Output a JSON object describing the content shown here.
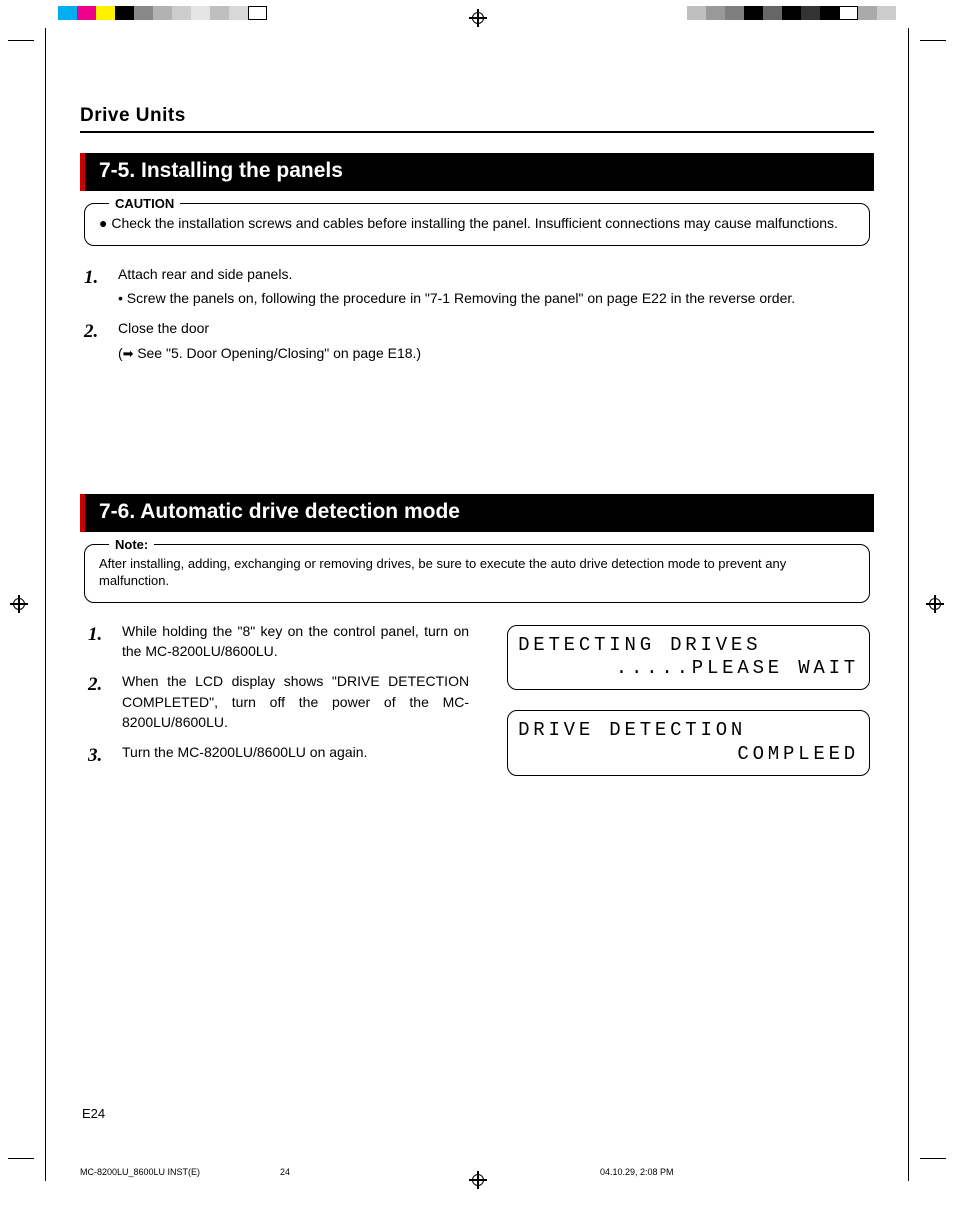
{
  "header": "Drive Units",
  "section75": {
    "title": "7-5. Installing the panels",
    "caution_label": "CAUTION",
    "caution_text": "● Check the installation screws and cables before installing the panel. Insufficient connections may cause malfunctions.",
    "steps": [
      {
        "num": "1.",
        "main": "Attach rear and side panels.",
        "sub": "Screw the panels on, following the procedure in \"7-1 Removing the panel\" on page E22 in the reverse order."
      },
      {
        "num": "2.",
        "main": "Close the door",
        "ref": "See \"5. Door Opening/Closing\" on page E18.)"
      }
    ]
  },
  "section76": {
    "title": "7-6. Automatic drive detection mode",
    "note_label": "Note:",
    "note_text": "After installing, adding, exchanging or removing drives, be sure to execute the auto drive detection mode to prevent any malfunction.",
    "steps": [
      {
        "num": "1.",
        "text": "While holding the \"8\" key on the control panel, turn on the MC-8200LU/8600LU."
      },
      {
        "num": "2.",
        "text": "When the LCD display shows \"DRIVE DETECTION COMPLETED\", turn off the power of the MC-8200LU/8600LU."
      },
      {
        "num": "3.",
        "text": "Turn the MC-8200LU/8600LU on again."
      }
    ],
    "lcd1_l1": "DETECTING DRIVES",
    "lcd1_l2": ".....PLEASE WAIT",
    "lcd2_l1": "DRIVE DETECTION",
    "lcd2_l2": "COMPLEED"
  },
  "footer": {
    "page_label": "E24",
    "slug_file": "MC-8200LU_8600LU INST(E)",
    "slug_page": "24",
    "slug_time": "04.10.29, 2:08 PM"
  }
}
